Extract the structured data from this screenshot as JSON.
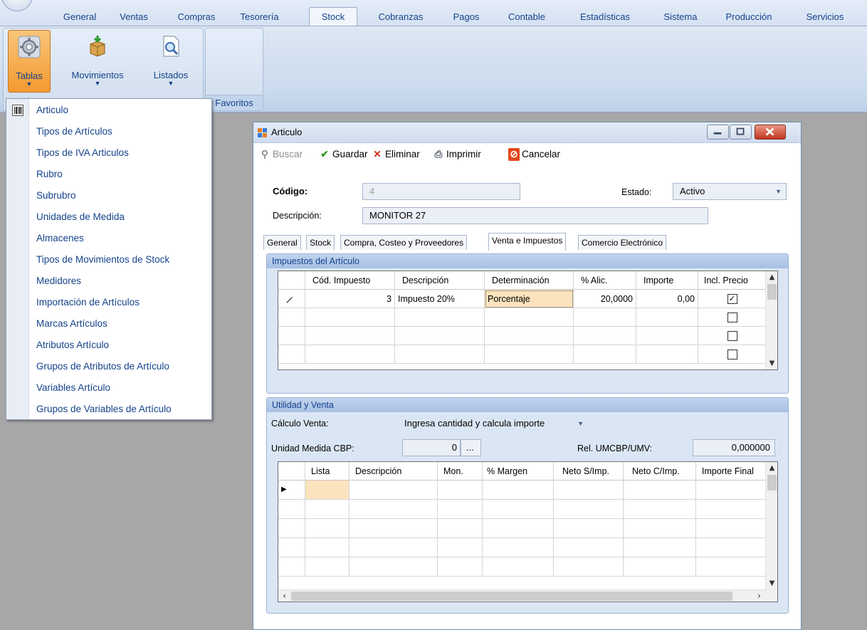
{
  "ribbon": {
    "tabs": [
      {
        "label": "General",
        "active": false
      },
      {
        "label": "Ventas",
        "active": false
      },
      {
        "label": "Compras",
        "active": false
      },
      {
        "label": "Tesorería",
        "active": false
      },
      {
        "label": "Stock",
        "active": true
      },
      {
        "label": "Cobranzas",
        "active": false
      },
      {
        "label": "Pagos",
        "active": false
      },
      {
        "label": "Contable",
        "active": false
      },
      {
        "label": "Estadísticas",
        "active": false
      },
      {
        "label": "Sistema",
        "active": false
      },
      {
        "label": "Producción",
        "active": false
      },
      {
        "label": "Servicios",
        "active": false
      }
    ],
    "buttons": {
      "tablas": "Tablas",
      "movimientos": "Movimientos",
      "listados": "Listados"
    },
    "groups": {
      "favoritos": "Favoritos"
    }
  },
  "menu": {
    "items": [
      "Articulo",
      "Tipos de Artículos",
      "Tipos de IVA Articulos",
      "Rubro",
      "Subrubro",
      "Unidades de Medida",
      "Almacenes",
      "Tipos de Movimientos de Stock",
      "Medidores",
      "Importación de Artículos",
      "Marcas Artículos",
      "Atributos Artículo",
      "Grupos de Atributos de Artículo",
      "Variables Artículo",
      "Grupos de Variables de Artículo"
    ]
  },
  "window": {
    "title": "Articulo",
    "toolbar": {
      "buscar": "Buscar",
      "guardar": "Guardar",
      "eliminar": "Eliminar",
      "imprimir": "Imprimir",
      "cancelar": "Cancelar"
    },
    "form": {
      "codigo_label": "Código:",
      "codigo_value": "4",
      "estado_label": "Estado:",
      "estado_value": "Activo",
      "descripcion_label": "Descripción:",
      "descripcion_value": "MONITOR 27"
    },
    "tabs": [
      "General",
      "Stock",
      "Compra, Costeo y Proveedores",
      "Venta e Impuestos",
      "Comercio Electrónico"
    ],
    "active_tab": "Venta e Impuestos",
    "impuestos": {
      "title": "Impuestos del Artículo",
      "columns": [
        "Cód. Impuesto",
        "Descripción",
        "Determinación",
        "% Alic.",
        "Importe",
        "Incl. Precio"
      ],
      "rows": [
        {
          "codigo": "3",
          "descripcion": "Impuesto 20%",
          "determinacion": "Porcentaje",
          "alic": "20,0000",
          "importe": "0,00",
          "incl": true
        },
        {
          "codigo": "",
          "descripcion": "",
          "determinacion": "",
          "alic": "",
          "importe": "",
          "incl": false
        },
        {
          "codigo": "",
          "descripcion": "",
          "determinacion": "",
          "alic": "",
          "importe": "",
          "incl": false
        },
        {
          "codigo": "",
          "descripcion": "",
          "determinacion": "",
          "alic": "",
          "importe": "",
          "incl": false
        }
      ]
    },
    "utilidad": {
      "title": "Utilidad y Venta",
      "calculo_label": "Cálculo Venta:",
      "calculo_value": "Ingresa cantidad y calcula importe",
      "unidad_label": "Unidad Medida CBP:",
      "unidad_value": "0",
      "unidad_button": "...",
      "rel_label": "Rel. UMCBP/UMV:",
      "rel_value": "0,000000",
      "columns": [
        "Lista",
        "Descripción",
        "Mon.",
        "% Margen",
        "Neto S/Imp.",
        "Neto C/Imp.",
        "Importe Final"
      ]
    }
  },
  "colors": {
    "ribbon_text": "#15428b",
    "pressed_button": "#f39a2f",
    "selected_cell": "#fbe3bd",
    "desktop_background": "#a7a7a7"
  }
}
